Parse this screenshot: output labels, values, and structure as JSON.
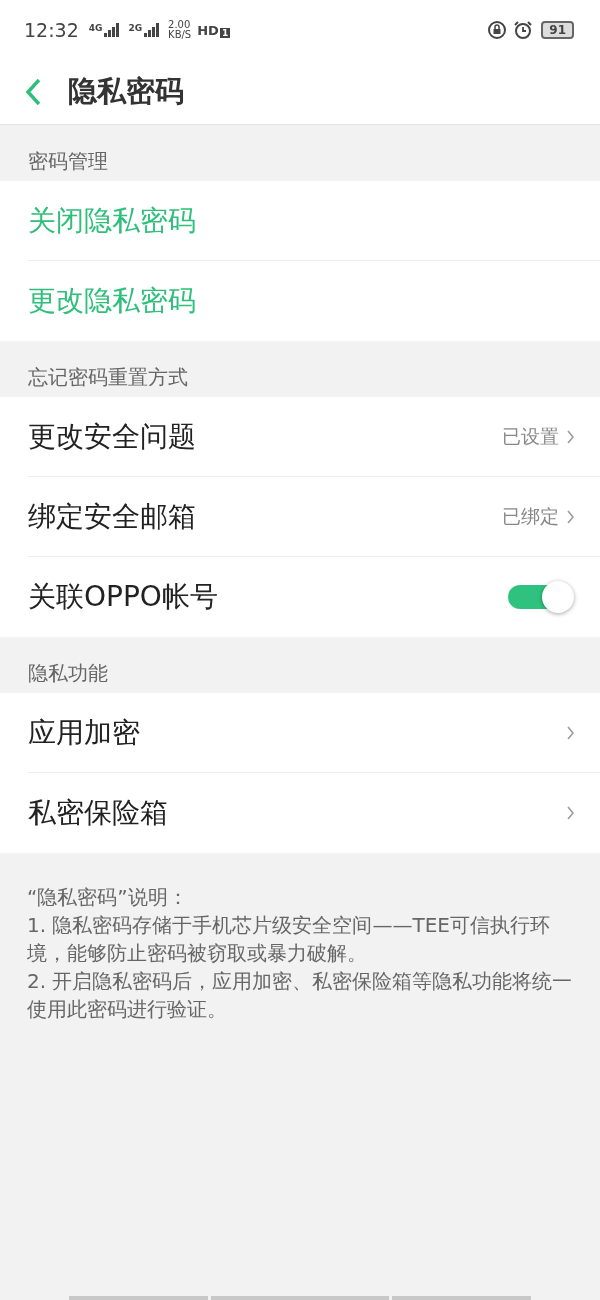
{
  "status_bar": {
    "time": "12:32",
    "network_1": "4G",
    "network_2": "2G",
    "speed": "2.00",
    "speed_unit": "KB/S",
    "hd": "HD",
    "hd_sim": "1",
    "battery": "91"
  },
  "header": {
    "title": "隐私密码"
  },
  "sections": [
    {
      "title": "密码管理",
      "items": [
        {
          "kind": "action",
          "label": "关闭隐私密码"
        },
        {
          "kind": "action",
          "label": "更改隐私密码"
        }
      ]
    },
    {
      "title": "忘记密码重置方式",
      "items": [
        {
          "kind": "nav",
          "label": "更改安全问题",
          "value": "已设置"
        },
        {
          "kind": "nav",
          "label": "绑定安全邮箱",
          "value": "已绑定"
        },
        {
          "kind": "toggle",
          "label": "关联OPPO帐号",
          "on": true
        }
      ]
    },
    {
      "title": "隐私功能",
      "items": [
        {
          "kind": "nav",
          "label": "应用加密"
        },
        {
          "kind": "nav",
          "label": "私密保险箱"
        }
      ]
    }
  ],
  "note": [
    "“隐私密码”说明：",
    "1. 隐私密码存储于手机芯片级安全空间——TEE可信执行环境，能够防止密码被窃取或暴力破解。",
    "2. 开启隐私密码后，应用加密、私密保险箱等隐私功能将统一使用此密码进行验证。"
  ]
}
